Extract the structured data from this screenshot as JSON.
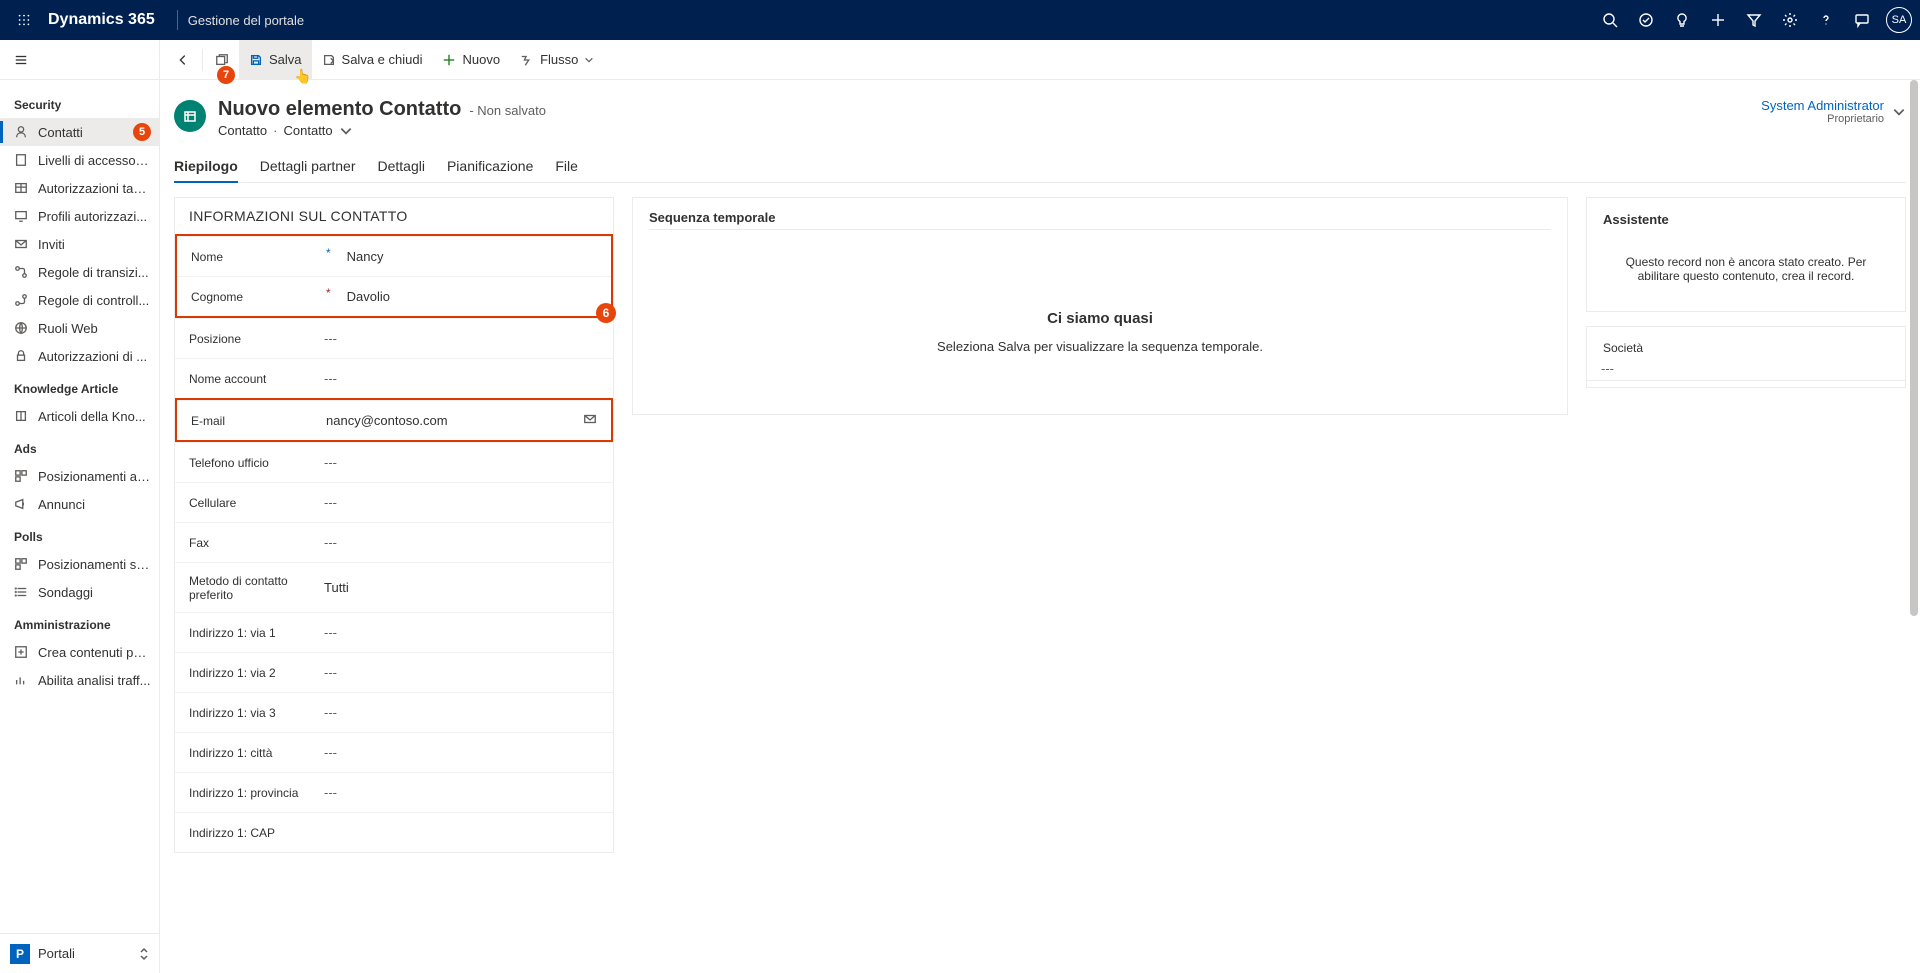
{
  "header": {
    "brand": "Dynamics 365",
    "portal_mgmt": "Gestione del portale",
    "avatar": "SA"
  },
  "nav": {
    "groups": [
      {
        "title": "Security",
        "items": [
          {
            "label": "Contatti",
            "active": true,
            "badge": "5"
          },
          {
            "label": "Livelli di accesso a..."
          },
          {
            "label": "Autorizzazioni tab..."
          },
          {
            "label": "Profili autorizzazi..."
          },
          {
            "label": "Inviti"
          },
          {
            "label": "Regole di transizi..."
          },
          {
            "label": "Regole di controll..."
          },
          {
            "label": "Ruoli Web"
          },
          {
            "label": "Autorizzazioni di ..."
          }
        ]
      },
      {
        "title": "Knowledge Article",
        "items": [
          {
            "label": "Articoli della Kno..."
          }
        ]
      },
      {
        "title": "Ads",
        "items": [
          {
            "label": "Posizionamenti an..."
          },
          {
            "label": "Annunci"
          }
        ]
      },
      {
        "title": "Polls",
        "items": [
          {
            "label": "Posizionamenti so..."
          },
          {
            "label": "Sondaggi"
          }
        ]
      },
      {
        "title": "Amministrazione",
        "items": [
          {
            "label": "Crea contenuti po..."
          },
          {
            "label": "Abilita analisi traff..."
          }
        ]
      }
    ],
    "footer": "Portali"
  },
  "commands": {
    "save": "Salva",
    "save_close": "Salva e chiudi",
    "new": "Nuovo",
    "flow": "Flusso",
    "badge7": "7"
  },
  "record": {
    "title": "Nuovo elemento Contatto",
    "unsaved": "- Non salvato",
    "bc1": "Contatto",
    "bc2": "Contatto",
    "owner_name": "System Administrator",
    "owner_label": "Proprietario"
  },
  "tabs": [
    "Riepilogo",
    "Dettagli partner",
    "Dettagli",
    "Pianificazione",
    "File"
  ],
  "contact_section": {
    "title": "INFORMAZIONI SUL CONTATTO",
    "fields": {
      "nome_label": "Nome",
      "nome_value": "Nancy",
      "cognome_label": "Cognome",
      "cognome_value": "Davolio",
      "posizione_label": "Posizione",
      "posizione_value": "---",
      "account_label": "Nome account",
      "account_value": "---",
      "email_label": "E-mail",
      "email_value": "nancy@contoso.com",
      "tel_label": "Telefono ufficio",
      "tel_value": "---",
      "cell_label": "Cellulare",
      "cell_value": "---",
      "fax_label": "Fax",
      "fax_value": "---",
      "metodo_label": "Metodo di contatto preferito",
      "metodo_value": "Tutti",
      "via1_label": "Indirizzo 1: via 1",
      "via1_value": "---",
      "via2_label": "Indirizzo 1: via 2",
      "via2_value": "---",
      "via3_label": "Indirizzo 1: via 3",
      "via3_value": "---",
      "citta_label": "Indirizzo 1: città",
      "citta_value": "---",
      "prov_label": "Indirizzo 1: provincia",
      "prov_value": "---",
      "cap_label": "Indirizzo 1: CAP"
    },
    "badge6": "6"
  },
  "timeline": {
    "title": "Sequenza temporale",
    "headline": "Ci siamo quasi",
    "sub": "Seleziona Salva per visualizzare la sequenza temporale."
  },
  "assistant": {
    "title": "Assistente",
    "body": "Questo record non è ancora stato creato. Per abilitare questo contenuto, crea il record."
  },
  "society": {
    "label": "Società",
    "value": "---"
  }
}
